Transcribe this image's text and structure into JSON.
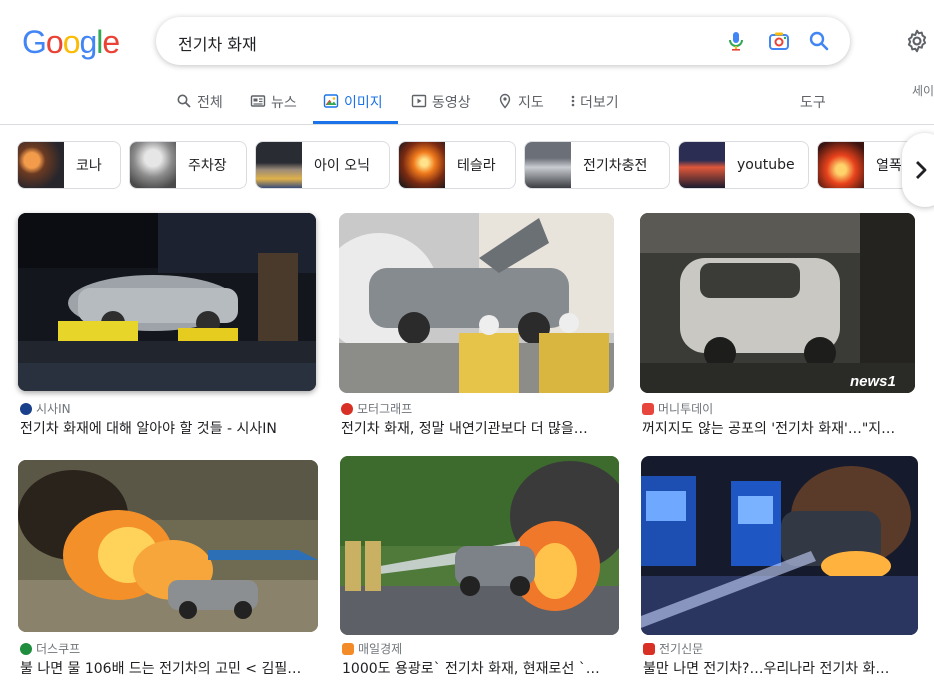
{
  "search": {
    "query": "전기차 화재"
  },
  "tabs": [
    {
      "label": "전체",
      "icon": "search-icon"
    },
    {
      "label": "뉴스",
      "icon": "news-icon"
    },
    {
      "label": "이미지",
      "icon": "image-icon",
      "active": true
    },
    {
      "label": "동영상",
      "icon": "video-icon"
    },
    {
      "label": "지도",
      "icon": "map-pin-icon"
    },
    {
      "label": "더보기",
      "icon": "more-vert-icon"
    }
  ],
  "tools_label": "도구",
  "cut_text": "세이",
  "chips": [
    {
      "label": "코나"
    },
    {
      "label": "주차장"
    },
    {
      "label": "아이 오닉"
    },
    {
      "label": "테슬라"
    },
    {
      "label": "전기차충전"
    },
    {
      "label": "youtube"
    },
    {
      "label": "열폭"
    }
  ],
  "results": [
    {
      "source": "시사IN",
      "title": "전기차 화재에 대해 알아야 할 것들 - 시사IN",
      "fav_color": "#1a3f8b"
    },
    {
      "source": "모터그래프",
      "title": "전기차 화재, 정말 내연기관보다 더 많을…",
      "fav_color": "#d93025"
    },
    {
      "source": "머니투데이",
      "title": "꺼지지도 않는 공포의 '전기차 화재'…\"지…",
      "fav_color": "#e8453c"
    },
    {
      "source": "더스쿠프",
      "title": "불 나면 물 106배 드는 전기차의 고민 < 김필…",
      "fav_color": "#1e8e3e"
    },
    {
      "source": "매일경제",
      "title": "1000도 용광로` 전기차 화재, 현재로선 `…",
      "fav_color": "#f28b28"
    },
    {
      "source": "전기신문",
      "title": "불만 나면 전기차?…우리나라 전기차 화…",
      "fav_color": "#d93025"
    }
  ],
  "watermark": "news1",
  "colors": {
    "accent": "#1a73e8",
    "text": "#202124",
    "muted": "#70757a",
    "border": "#dadce0"
  }
}
